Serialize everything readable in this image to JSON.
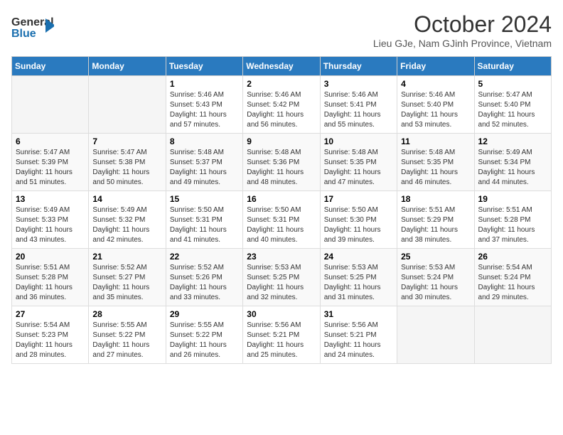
{
  "header": {
    "logo_line1": "General",
    "logo_line2": "Blue",
    "month": "October 2024",
    "location": "Lieu GJe, Nam GJinh Province, Vietnam"
  },
  "days_of_week": [
    "Sunday",
    "Monday",
    "Tuesday",
    "Wednesday",
    "Thursday",
    "Friday",
    "Saturday"
  ],
  "weeks": [
    [
      {
        "num": "",
        "info": ""
      },
      {
        "num": "",
        "info": ""
      },
      {
        "num": "1",
        "info": "Sunrise: 5:46 AM\nSunset: 5:43 PM\nDaylight: 11 hours\nand 57 minutes."
      },
      {
        "num": "2",
        "info": "Sunrise: 5:46 AM\nSunset: 5:42 PM\nDaylight: 11 hours\nand 56 minutes."
      },
      {
        "num": "3",
        "info": "Sunrise: 5:46 AM\nSunset: 5:41 PM\nDaylight: 11 hours\nand 55 minutes."
      },
      {
        "num": "4",
        "info": "Sunrise: 5:46 AM\nSunset: 5:40 PM\nDaylight: 11 hours\nand 53 minutes."
      },
      {
        "num": "5",
        "info": "Sunrise: 5:47 AM\nSunset: 5:40 PM\nDaylight: 11 hours\nand 52 minutes."
      }
    ],
    [
      {
        "num": "6",
        "info": "Sunrise: 5:47 AM\nSunset: 5:39 PM\nDaylight: 11 hours\nand 51 minutes."
      },
      {
        "num": "7",
        "info": "Sunrise: 5:47 AM\nSunset: 5:38 PM\nDaylight: 11 hours\nand 50 minutes."
      },
      {
        "num": "8",
        "info": "Sunrise: 5:48 AM\nSunset: 5:37 PM\nDaylight: 11 hours\nand 49 minutes."
      },
      {
        "num": "9",
        "info": "Sunrise: 5:48 AM\nSunset: 5:36 PM\nDaylight: 11 hours\nand 48 minutes."
      },
      {
        "num": "10",
        "info": "Sunrise: 5:48 AM\nSunset: 5:35 PM\nDaylight: 11 hours\nand 47 minutes."
      },
      {
        "num": "11",
        "info": "Sunrise: 5:48 AM\nSunset: 5:35 PM\nDaylight: 11 hours\nand 46 minutes."
      },
      {
        "num": "12",
        "info": "Sunrise: 5:49 AM\nSunset: 5:34 PM\nDaylight: 11 hours\nand 44 minutes."
      }
    ],
    [
      {
        "num": "13",
        "info": "Sunrise: 5:49 AM\nSunset: 5:33 PM\nDaylight: 11 hours\nand 43 minutes."
      },
      {
        "num": "14",
        "info": "Sunrise: 5:49 AM\nSunset: 5:32 PM\nDaylight: 11 hours\nand 42 minutes."
      },
      {
        "num": "15",
        "info": "Sunrise: 5:50 AM\nSunset: 5:31 PM\nDaylight: 11 hours\nand 41 minutes."
      },
      {
        "num": "16",
        "info": "Sunrise: 5:50 AM\nSunset: 5:31 PM\nDaylight: 11 hours\nand 40 minutes."
      },
      {
        "num": "17",
        "info": "Sunrise: 5:50 AM\nSunset: 5:30 PM\nDaylight: 11 hours\nand 39 minutes."
      },
      {
        "num": "18",
        "info": "Sunrise: 5:51 AM\nSunset: 5:29 PM\nDaylight: 11 hours\nand 38 minutes."
      },
      {
        "num": "19",
        "info": "Sunrise: 5:51 AM\nSunset: 5:28 PM\nDaylight: 11 hours\nand 37 minutes."
      }
    ],
    [
      {
        "num": "20",
        "info": "Sunrise: 5:51 AM\nSunset: 5:28 PM\nDaylight: 11 hours\nand 36 minutes."
      },
      {
        "num": "21",
        "info": "Sunrise: 5:52 AM\nSunset: 5:27 PM\nDaylight: 11 hours\nand 35 minutes."
      },
      {
        "num": "22",
        "info": "Sunrise: 5:52 AM\nSunset: 5:26 PM\nDaylight: 11 hours\nand 33 minutes."
      },
      {
        "num": "23",
        "info": "Sunrise: 5:53 AM\nSunset: 5:25 PM\nDaylight: 11 hours\nand 32 minutes."
      },
      {
        "num": "24",
        "info": "Sunrise: 5:53 AM\nSunset: 5:25 PM\nDaylight: 11 hours\nand 31 minutes."
      },
      {
        "num": "25",
        "info": "Sunrise: 5:53 AM\nSunset: 5:24 PM\nDaylight: 11 hours\nand 30 minutes."
      },
      {
        "num": "26",
        "info": "Sunrise: 5:54 AM\nSunset: 5:24 PM\nDaylight: 11 hours\nand 29 minutes."
      }
    ],
    [
      {
        "num": "27",
        "info": "Sunrise: 5:54 AM\nSunset: 5:23 PM\nDaylight: 11 hours\nand 28 minutes."
      },
      {
        "num": "28",
        "info": "Sunrise: 5:55 AM\nSunset: 5:22 PM\nDaylight: 11 hours\nand 27 minutes."
      },
      {
        "num": "29",
        "info": "Sunrise: 5:55 AM\nSunset: 5:22 PM\nDaylight: 11 hours\nand 26 minutes."
      },
      {
        "num": "30",
        "info": "Sunrise: 5:56 AM\nSunset: 5:21 PM\nDaylight: 11 hours\nand 25 minutes."
      },
      {
        "num": "31",
        "info": "Sunrise: 5:56 AM\nSunset: 5:21 PM\nDaylight: 11 hours\nand 24 minutes."
      },
      {
        "num": "",
        "info": ""
      },
      {
        "num": "",
        "info": ""
      }
    ]
  ]
}
